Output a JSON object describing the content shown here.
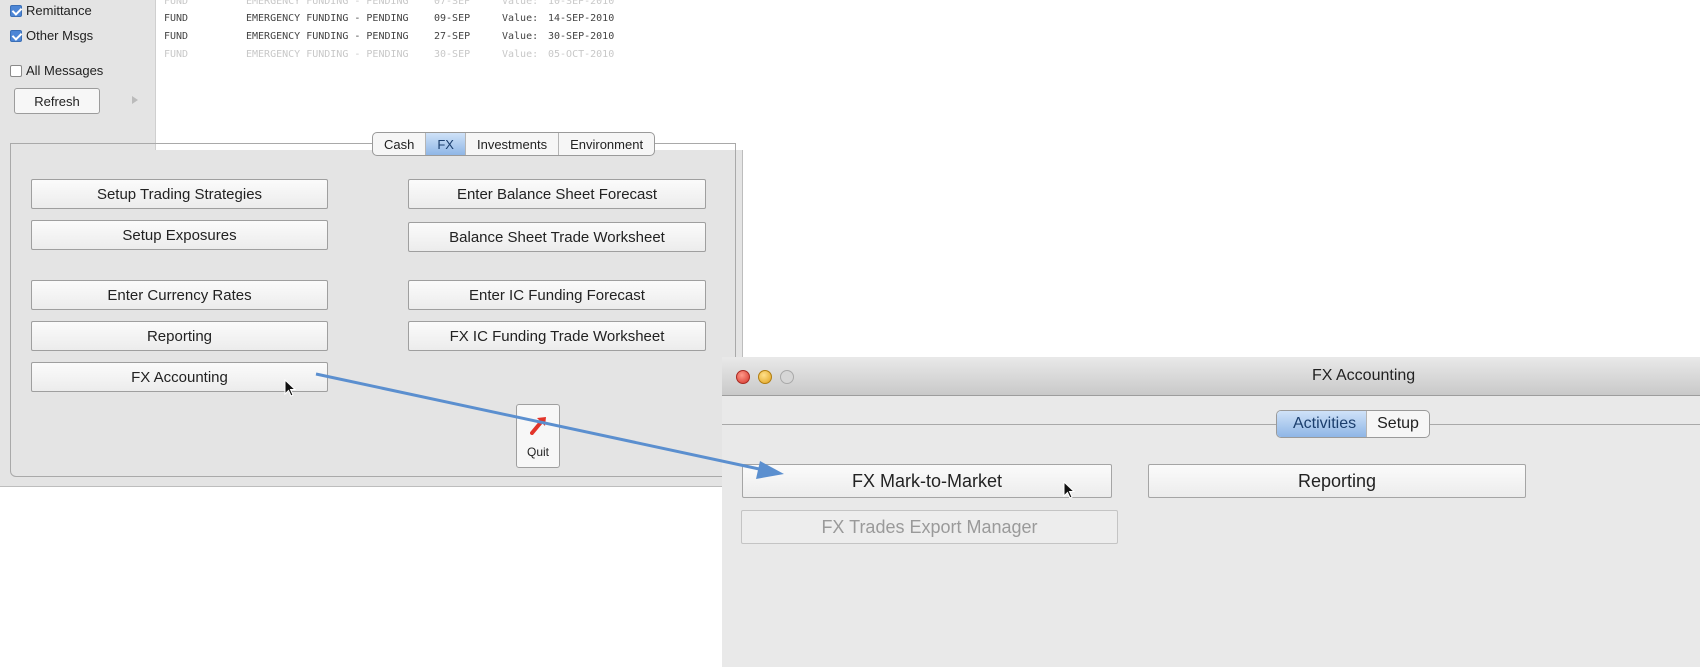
{
  "main_window": {
    "filters": [
      {
        "label": "Remittance",
        "checked": true
      },
      {
        "label": "Other Msgs",
        "checked": true
      },
      {
        "label": "All Messages",
        "checked": false
      }
    ],
    "refresh_label": "Refresh",
    "messages": [
      {
        "type": "FUND",
        "desc": "EMERGENCY FUNDING - PENDING",
        "date": "09-SEP",
        "value_label": "Value:",
        "value": "14-SEP-2010"
      },
      {
        "type": "FUND",
        "desc": "EMERGENCY FUNDING - PENDING",
        "date": "27-SEP",
        "value_label": "Value:",
        "value": "30-SEP-2010"
      }
    ],
    "tabs": [
      {
        "label": "Cash",
        "selected": false
      },
      {
        "label": "FX",
        "selected": true
      },
      {
        "label": "Investments",
        "selected": false
      },
      {
        "label": "Environment",
        "selected": false
      }
    ],
    "buttons": {
      "setup_trading_strategies": "Setup Trading Strategies",
      "setup_exposures": "Setup Exposures",
      "enter_currency_rates": "Enter Currency Rates",
      "reporting": "Reporting",
      "fx_accounting": "FX Accounting",
      "enter_balance_sheet_forecast": "Enter Balance Sheet Forecast",
      "balance_sheet_trade_worksheet": "Balance Sheet Trade Worksheet",
      "enter_ic_funding_forecast": "Enter IC Funding Forecast",
      "fx_ic_funding_trade_worksheet": "FX IC Funding Trade Worksheet"
    },
    "quit_label": "Quit"
  },
  "fx_window": {
    "title": "FX Accounting",
    "tabs": [
      {
        "label": "Activities",
        "selected": true
      },
      {
        "label": "Setup",
        "selected": false
      }
    ],
    "buttons": {
      "fx_mark_to_market": "FX Mark-to-Market",
      "reporting": "Reporting",
      "fx_trades_export_manager": "FX Trades Export Manager"
    }
  },
  "colors": {
    "selected_tab": "#8fb6e6",
    "annotation_arrow": "#5b8fcf",
    "quit_icon": "#e2342a"
  }
}
